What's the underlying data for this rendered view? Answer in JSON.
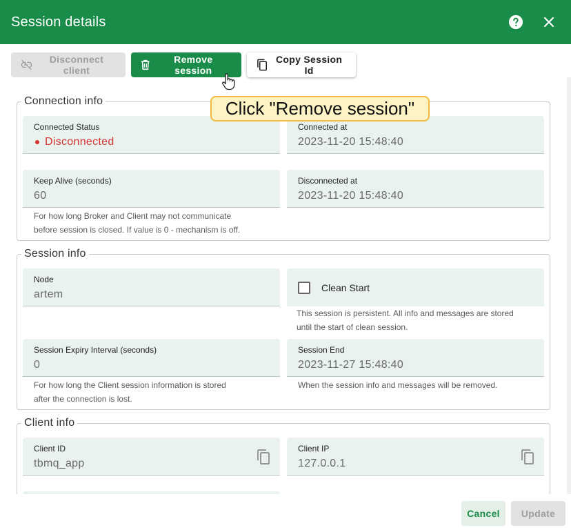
{
  "header": {
    "title": "Session details",
    "help_icon": "help-circle-icon",
    "close_icon": "close-icon",
    "color": "#1a8c49"
  },
  "toolbar": {
    "disconnect_label": "Disconnect client",
    "remove_label": "Remove session",
    "copy_label": "Copy Session Id"
  },
  "tooltip": {
    "text": "Click \"Remove session\""
  },
  "connection_info": {
    "legend": "Connection info",
    "connected_status_label": "Connected Status",
    "connected_status_value": "Disconnected",
    "connected_at_label": "Connected at",
    "connected_at_value": "2023-11-20 15:48:40",
    "keep_alive_label": "Keep Alive (seconds)",
    "keep_alive_value": "60",
    "keep_alive_hint_1": "For how long Broker and Client may not communicate",
    "keep_alive_hint_2": "before session is closed. If value is 0 - mechanism is off.",
    "disconnected_at_label": "Disconnected at",
    "disconnected_at_value": "2023-11-20 15:48:40"
  },
  "session_info": {
    "legend": "Session info",
    "node_label": "Node",
    "node_value": "artem",
    "clean_start_label": "Clean Start",
    "clean_start_checked": false,
    "clean_start_hint_1": "This session is persistent. All info and messages are stored",
    "clean_start_hint_2": "until the start of clean session.",
    "expiry_label": "Session Expiry Interval (seconds)",
    "expiry_value": "0",
    "expiry_hint_1": "For how long the Client session information is stored",
    "expiry_hint_2": "after the connection is lost.",
    "session_end_label": "Session End",
    "session_end_value": "2023-11-27 15:48:40",
    "session_end_hint": "When the session info and messages will be removed."
  },
  "client_info": {
    "legend": "Client info",
    "client_id_label": "Client ID",
    "client_id_value": "tbmq_app",
    "client_ip_label": "Client IP",
    "client_ip_value": "127.0.0.1"
  },
  "footer": {
    "cancel_label": "Cancel",
    "update_label": "Update"
  }
}
